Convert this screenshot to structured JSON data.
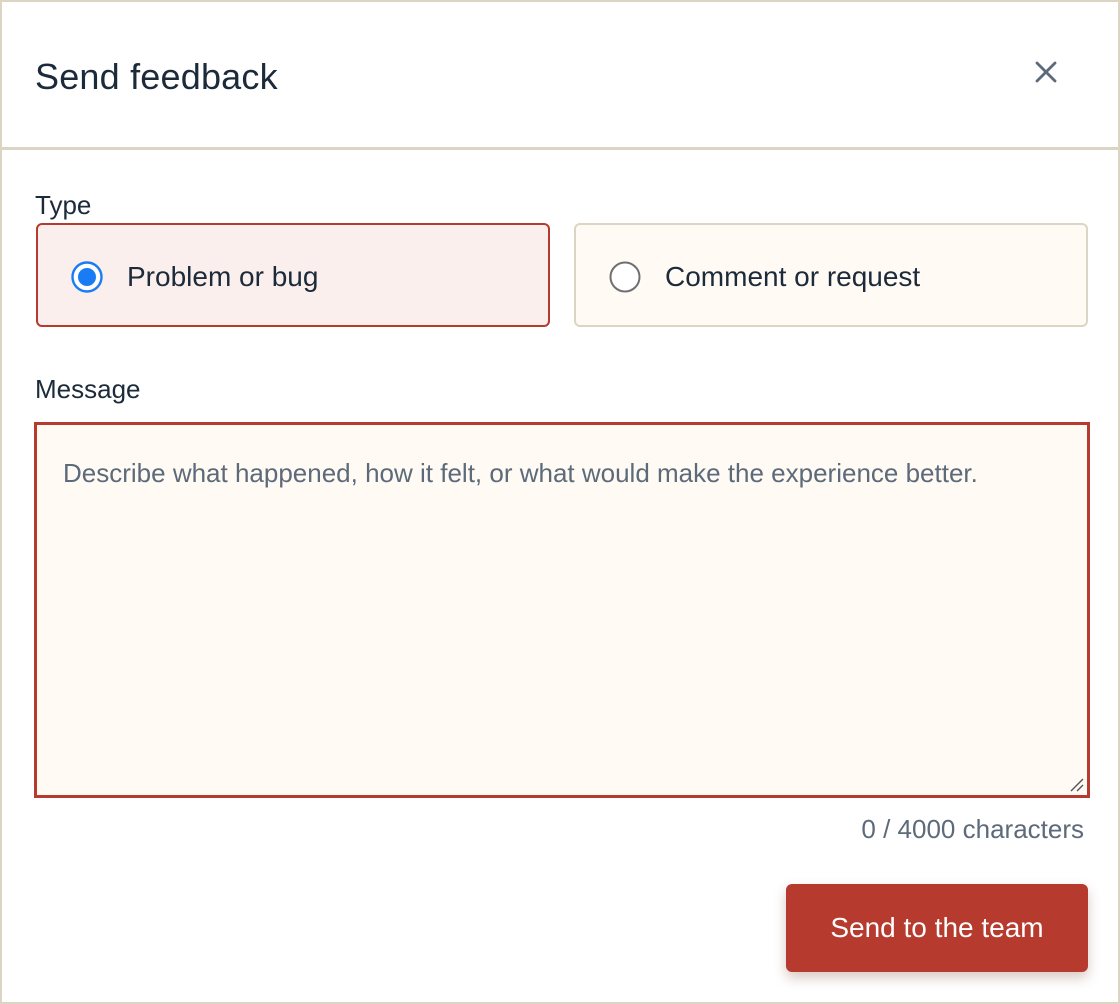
{
  "dialog": {
    "title": "Send feedback",
    "close_icon": "close-icon"
  },
  "type_section": {
    "label": "Type",
    "options": [
      {
        "label": "Problem or bug",
        "selected": true
      },
      {
        "label": "Comment or request",
        "selected": false
      }
    ]
  },
  "message_section": {
    "label": "Message",
    "value": "",
    "placeholder": "Describe what happened, how it felt, or what would make the experience better.",
    "char_count": "0 / 4000 characters"
  },
  "actions": {
    "send_label": "Send to the team"
  },
  "colors": {
    "accent": "#b63a2d",
    "radio_selected": "#1a7cf5",
    "border": "#ddd5c4",
    "field_bg": "#fffbf4",
    "selected_bg": "#faefec",
    "text": "#1c2a3a",
    "muted_text": "#5c6a7a"
  }
}
